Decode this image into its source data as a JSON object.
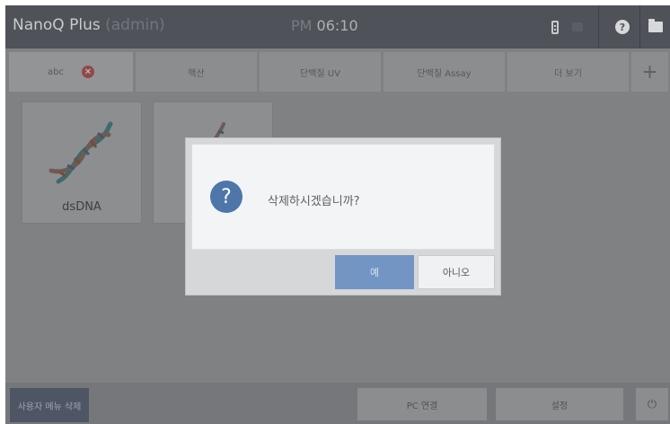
{
  "header": {
    "app_name": "NanoQ Plus",
    "role": "(admin)",
    "ampm": "PM",
    "time": "06:10",
    "help_glyph": "?",
    "icons": [
      "battery-icon",
      "status-icon",
      "help-icon",
      "folder-icon"
    ]
  },
  "tabs": [
    {
      "label": "abc",
      "close_glyph": "✕"
    },
    {
      "label": "핵산"
    },
    {
      "label": "단백질 UV"
    },
    {
      "label": "단백질 Assay"
    },
    {
      "label": "더 보기"
    },
    {
      "label": "+"
    }
  ],
  "tiles": [
    {
      "label": "dsDNA",
      "icon": "dna-icon"
    },
    {
      "label": "",
      "icon": "dna-icon"
    }
  ],
  "dialog": {
    "icon_glyph": "?",
    "message": "삭제하시겠습니까?",
    "yes_label": "예",
    "no_label": "아니오"
  },
  "bottom": {
    "delete_menu_label": "사용자 메뉴 삭제",
    "pc_label": "PC 연결",
    "settings_label": "설정",
    "power_glyph": "⏻"
  },
  "colors": {
    "header_bg": "#4f5359",
    "dialog_primary": "#7295c4",
    "question_icon": "#4e76a8",
    "tab_close": "#8e4a48"
  }
}
